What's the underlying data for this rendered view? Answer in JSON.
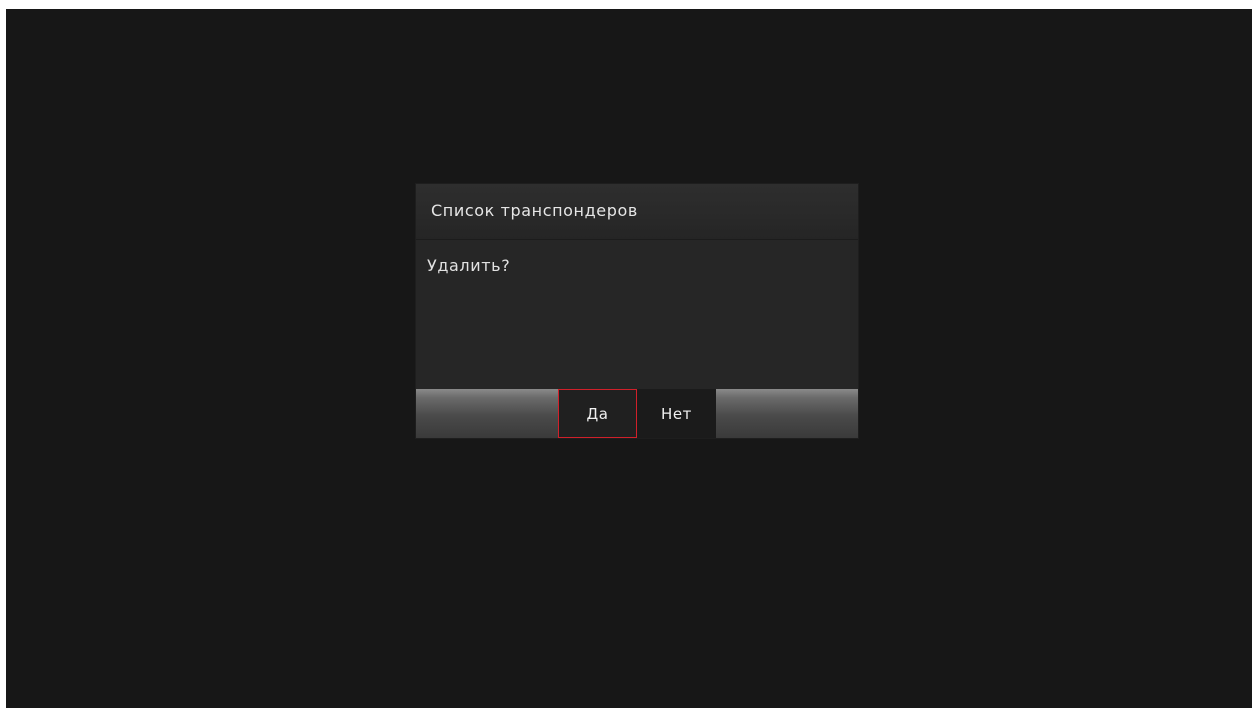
{
  "dialog": {
    "title": "Список транспондеров",
    "message": "Удалить?",
    "buttons": {
      "yes_label": "Да",
      "no_label": "Нет",
      "focused": "yes"
    }
  },
  "colors": {
    "background": "#171717",
    "dialog_bg": "#262626",
    "focus_border": "#d0202a",
    "text": "#e6e6e6"
  }
}
